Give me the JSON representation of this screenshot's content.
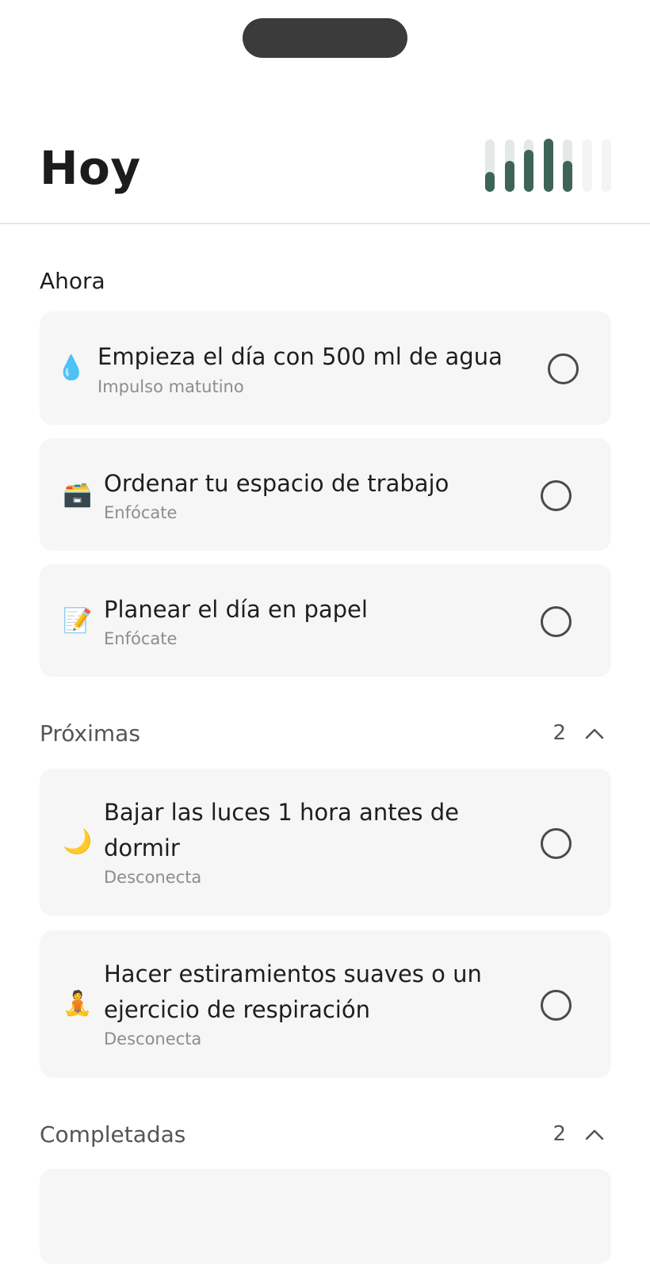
{
  "header": {
    "title": "Hoy"
  },
  "weekly_progress": {
    "icon": "weekly-progress-bars",
    "days": [
      {
        "level": 0.35
      },
      {
        "level": 0.55
      },
      {
        "level": 0.75
      },
      {
        "level": 0.95
      },
      {
        "level": 0.55
      },
      {
        "level": 0
      },
      {
        "level": 0
      }
    ],
    "colors": {
      "fill": "#3d6455",
      "track": "#e4e8e6",
      "track_empty": "#f4f4f4"
    }
  },
  "sections": {
    "now": {
      "title": "Ahora",
      "tasks": [
        {
          "emoji": "💧",
          "icon": "water-drop-icon",
          "title": "Empieza el día con 500 ml de agua",
          "subtitle": "Impulso matutino"
        },
        {
          "emoji": "🗃️",
          "icon": "card-file-box-icon",
          "title": "Ordenar tu espacio de trabajo",
          "subtitle": "Enfócate"
        },
        {
          "emoji": "📝",
          "icon": "memo-icon",
          "title": "Planear el día en papel",
          "subtitle": "Enfócate"
        }
      ]
    },
    "upcoming": {
      "title": "Próximas",
      "count": "2",
      "tasks": [
        {
          "emoji": "🌙",
          "icon": "crescent-moon-icon",
          "title": "Bajar las luces 1 hora antes de dormir",
          "subtitle": "Desconecta"
        },
        {
          "emoji": "🧘",
          "icon": "meditation-icon",
          "title": "Hacer estiramientos suaves o un ejercicio de respiración",
          "subtitle": "Desconecta"
        }
      ]
    },
    "completed": {
      "title": "Completadas",
      "count": "2"
    }
  }
}
